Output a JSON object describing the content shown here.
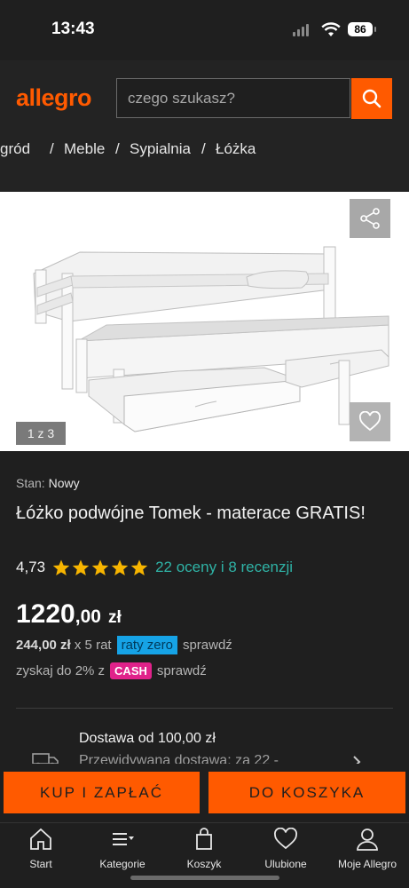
{
  "status_bar": {
    "time": "13:43",
    "battery": "86"
  },
  "header": {
    "logo": "allegro",
    "search": {
      "placeholder": "czego szukasz?"
    }
  },
  "breadcrumb": [
    "gród",
    "Meble",
    "Sypialnia",
    "Łóżka"
  ],
  "gallery": {
    "counter": "1 z 3"
  },
  "product": {
    "condition_label": "Stan:",
    "condition_value": "Nowy",
    "title": "Łóżko podwójne Tomek - materace GRATIS!",
    "rating_score": "4,73",
    "rating_stars": 5,
    "rating_text": "22 oceny i 8 recenzji",
    "price_int": "1220",
    "price_dec": ",00",
    "price_currency": "zł",
    "installment_amount": "244,00 zł",
    "installment_text": "x 5 rat",
    "installment_badge": "raty zero",
    "installment_link": "sprawdź",
    "cashback_text": "zyskaj do 2% z",
    "cashback_badge": "CASH",
    "cashback_link": "sprawdź"
  },
  "delivery": {
    "title": "Dostawa od 100,00 zł",
    "subtitle": "Przewidywana dostawa: za 22 -"
  },
  "actions": {
    "buy": "KUP I ZAPŁAĆ",
    "cart": "DO KOSZYKA"
  },
  "nav": [
    {
      "label": "Start",
      "icon": "home-icon"
    },
    {
      "label": "Kategorie",
      "icon": "categories-icon"
    },
    {
      "label": "Koszyk",
      "icon": "cart-icon"
    },
    {
      "label": "Ulubione",
      "icon": "heart-icon"
    },
    {
      "label": "Moje Allegro",
      "icon": "user-icon"
    }
  ],
  "colors": {
    "brand": "#ff5a00",
    "background": "#1f1f1f",
    "link": "#2fb3a6",
    "star": "#f7b500"
  }
}
